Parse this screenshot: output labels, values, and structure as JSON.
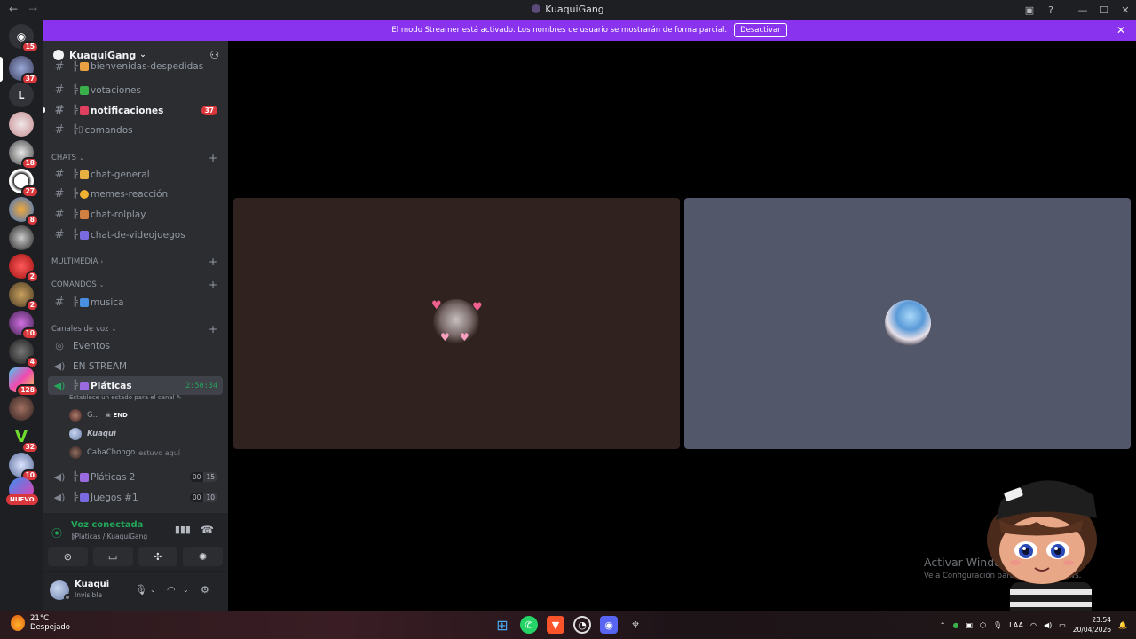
{
  "window": {
    "title": "KuaquiGang",
    "back": "←",
    "forward": "→"
  },
  "banner": {
    "text": "El modo Streamer está activado. Los nombres de usuario se mostrarán de forma parcial.",
    "button": "Desactivar",
    "close": "✕"
  },
  "rail": {
    "badges": [
      "15",
      "37",
      "18",
      "27",
      "8",
      "2",
      "2",
      "10",
      "4",
      "128",
      "32",
      "10"
    ],
    "letter_server": "L",
    "new_label": "NUEVO"
  },
  "server": {
    "name": "KuaquiGang"
  },
  "channels": {
    "bienvenidas": "bienvenidas-despedidas",
    "votaciones": "votaciones",
    "notificaciones": "notificaciones",
    "notificaciones_count": "37",
    "comandos": "comandos",
    "chat_general": "chat-general",
    "memes": "memes-reacción",
    "rolplay": "chat-rolplay",
    "videojuegos": "chat-de-videojuegos",
    "musica": "musica",
    "eventos": "Eventos",
    "en_stream": "EN STREAM",
    "platicas": "Pláticas",
    "platicas_timer": "2:50:34",
    "platicas_status": "Establece un estado para el canal",
    "platicas2": "Pláticas 2",
    "platicas2_a": "00",
    "platicas2_b": "15",
    "juegos": "Juegos #1",
    "juegos_a": "00",
    "juegos_b": "10"
  },
  "categories": {
    "chats": "CHATS",
    "multimedia": "MULTIMEDIA",
    "comandos": "COMANDOS",
    "voz": "Canales de voz"
  },
  "voice_users": [
    {
      "name": "G...",
      "tag": "END"
    },
    {
      "name": "Kuaqui"
    },
    {
      "name": "CabaChongo",
      "status": "estuvo aquí"
    }
  ],
  "voice_panel": {
    "title": "Voz conectada",
    "subtitle": "Pláticas / KuaquiGang"
  },
  "user": {
    "name": "Kuaqui",
    "status": "Invisible"
  },
  "watermark": {
    "line1": "Activar Windows",
    "line2": "Ve a Configuración para activar Windows."
  },
  "taskbar": {
    "temp": "21°C",
    "condition": "Despejado",
    "lang": "LAA",
    "time": "23:54",
    "date": "20/04/2026"
  },
  "colors": {
    "banner": "#8a33ee",
    "voice_green": "#23a55a",
    "badge_red": "#da373c"
  }
}
